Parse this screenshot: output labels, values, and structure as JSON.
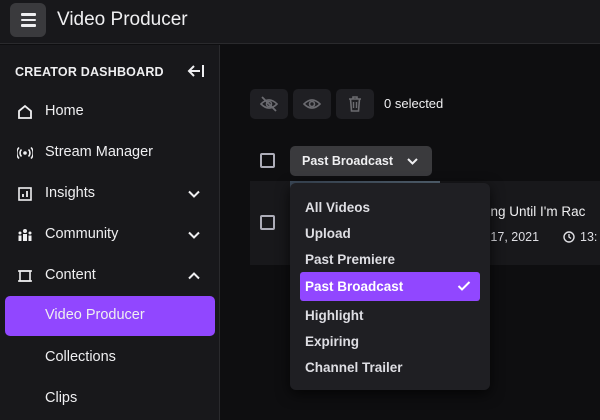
{
  "header": {
    "app_title": "Video Producer"
  },
  "sidebar": {
    "heading": "CREATOR DASHBOARD",
    "items": [
      {
        "label": "Home",
        "icon": "home-icon"
      },
      {
        "label": "Stream Manager",
        "icon": "broadcast-icon"
      },
      {
        "label": "Insights",
        "icon": "chart-icon",
        "expandable": true
      },
      {
        "label": "Community",
        "icon": "community-icon",
        "expandable": true
      },
      {
        "label": "Content",
        "icon": "content-icon",
        "expanded": true
      },
      {
        "label": "Video Producer",
        "active": true
      },
      {
        "label": "Collections"
      },
      {
        "label": "Clips"
      }
    ]
  },
  "toolbar": {
    "selected_count": "0 selected"
  },
  "filter": {
    "current": "Past Broadcast"
  },
  "video": {
    "title": "ding Until I'm Rac",
    "date": "h 17, 2021",
    "duration": "13:"
  },
  "dropdown": {
    "options": [
      "All Videos",
      "Upload",
      "Past Premiere",
      "Past Broadcast",
      "Highlight",
      "Expiring",
      "Channel Trailer"
    ],
    "selected_index": 3
  },
  "colors": {
    "accent": "#9147ff",
    "background": "#0e0e10",
    "panel": "#18181b"
  }
}
